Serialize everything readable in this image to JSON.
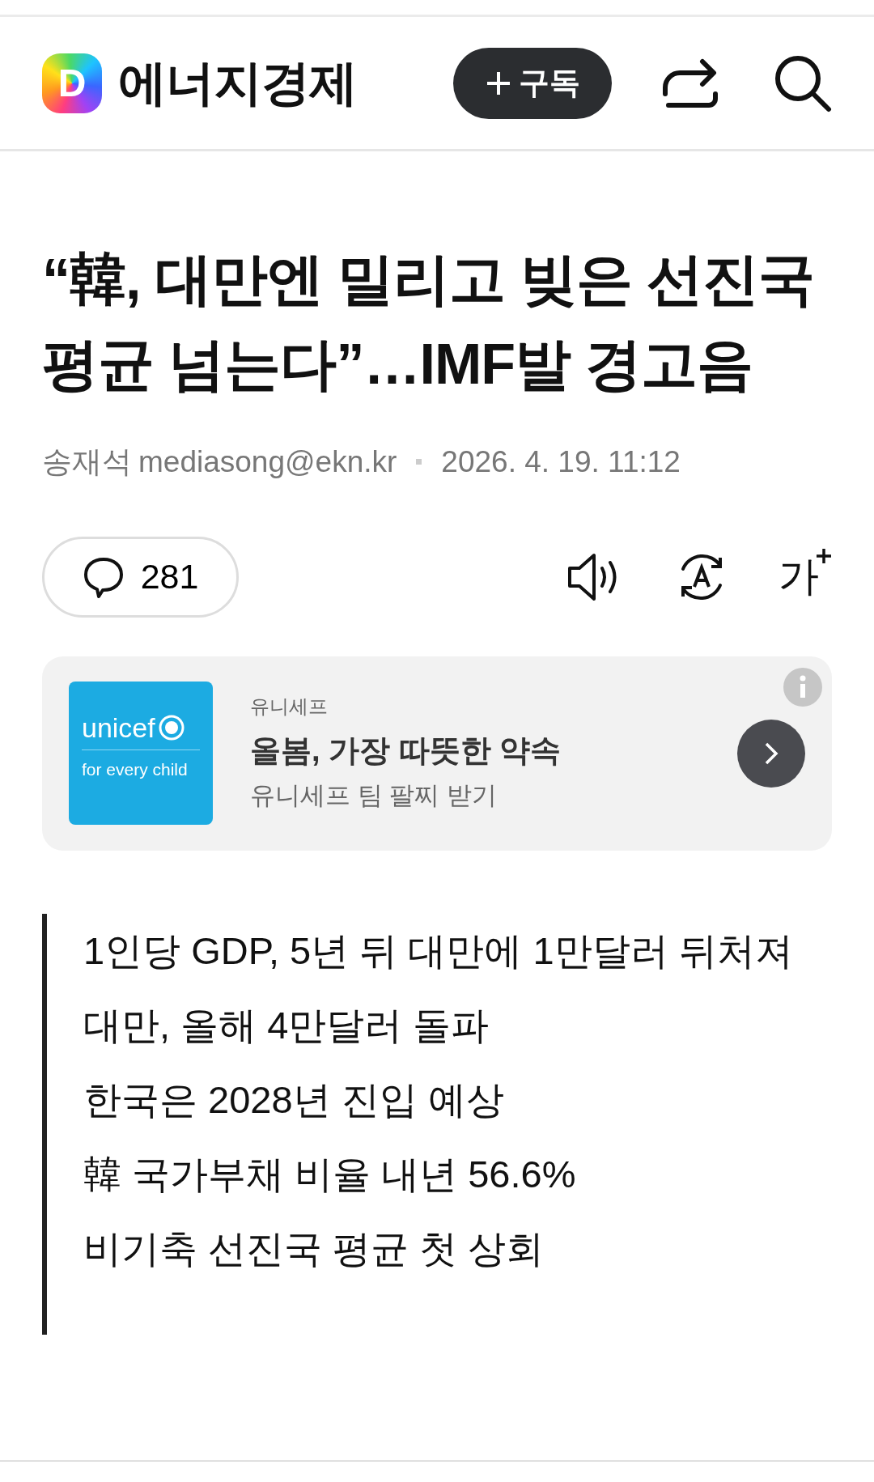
{
  "header": {
    "logo_letter": "D",
    "site_name": "에너지경제",
    "subscribe_label": "구독"
  },
  "article": {
    "title": "“韓, 대만엔 밀리고 빚은 선진국 평균 넘는다”…IMF발 경고음",
    "author": "송재석",
    "email": "mediasong@ekn.kr",
    "date": "2026. 4. 19. 11:12",
    "comment_count": "281",
    "font_size_label": "가"
  },
  "ad": {
    "logo_text": "unicef",
    "logo_tagline": "for every child",
    "advertiser": "유니세프",
    "headline": "올봄, 가장 따뜻한 약속",
    "subtitle": "유니세프 팀 팔찌 받기"
  },
  "summary": [
    "1인당 GDP, 5년 뒤 대만에 1만달러 뒤처져",
    "대만, 올해 4만달러 돌파",
    "한국은 2028년 진입 예상",
    "韓 국가부채 비율 내년 56.6%",
    "비기축 선진국 평균 첫 상회"
  ]
}
